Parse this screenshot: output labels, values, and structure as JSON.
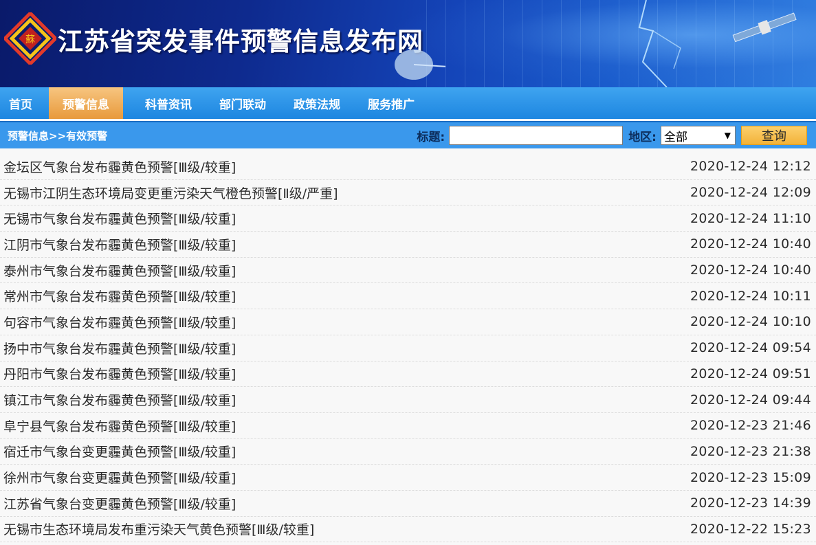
{
  "site": {
    "title": "江苏省突发事件预警信息发布网",
    "logo_icon": "su-logo-icon"
  },
  "nav": {
    "items": [
      {
        "label": "首页"
      },
      {
        "label": "预警信息"
      },
      {
        "label": "科普资讯"
      },
      {
        "label": "部门联动"
      },
      {
        "label": "政策法规"
      },
      {
        "label": "服务推广"
      }
    ],
    "active_index": 1
  },
  "filter": {
    "breadcrumb": "预警信息>>有效预警",
    "title_label": "标题:",
    "title_value": "",
    "region_label": "地区:",
    "region_selected": "全部",
    "query_button": "查询"
  },
  "warnings": [
    {
      "title": "金坛区气象台发布霾黄色预警[Ⅲ级/较重]",
      "time": "2020-12-24 12:12"
    },
    {
      "title": "无锡市江阴生态环境局变更重污染天气橙色预警[Ⅱ级/严重]",
      "time": "2020-12-24 12:09"
    },
    {
      "title": "无锡市气象台发布霾黄色预警[Ⅲ级/较重]",
      "time": "2020-12-24 11:10"
    },
    {
      "title": "江阴市气象台发布霾黄色预警[Ⅲ级/较重]",
      "time": "2020-12-24 10:40"
    },
    {
      "title": "泰州市气象台发布霾黄色预警[Ⅲ级/较重]",
      "time": "2020-12-24 10:40"
    },
    {
      "title": "常州市气象台发布霾黄色预警[Ⅲ级/较重]",
      "time": "2020-12-24 10:11"
    },
    {
      "title": "句容市气象台发布霾黄色预警[Ⅲ级/较重]",
      "time": "2020-12-24 10:10"
    },
    {
      "title": "扬中市气象台发布霾黄色预警[Ⅲ级/较重]",
      "time": "2020-12-24 09:54"
    },
    {
      "title": "丹阳市气象台发布霾黄色预警[Ⅲ级/较重]",
      "time": "2020-12-24 09:51"
    },
    {
      "title": "镇江市气象台发布霾黄色预警[Ⅲ级/较重]",
      "time": "2020-12-24 09:44"
    },
    {
      "title": "阜宁县气象台发布霾黄色预警[Ⅲ级/较重]",
      "time": "2020-12-23 21:46"
    },
    {
      "title": "宿迁市气象台变更霾黄色预警[Ⅲ级/较重]",
      "time": "2020-12-23 21:38"
    },
    {
      "title": "徐州市气象台变更霾黄色预警[Ⅲ级/较重]",
      "time": "2020-12-23 15:09"
    },
    {
      "title": "江苏省气象台变更霾黄色预警[Ⅲ级/较重]",
      "time": "2020-12-23 14:39"
    },
    {
      "title": "无锡市生态环境局发布重污染天气黄色预警[Ⅲ级/较重]",
      "time": "2020-12-22 15:23"
    }
  ],
  "colors": {
    "nav_bg": "#1d86e0",
    "nav_active": "#e89a3c",
    "subbar_bg": "#3a98ec",
    "query_button": "#f2b23a"
  }
}
